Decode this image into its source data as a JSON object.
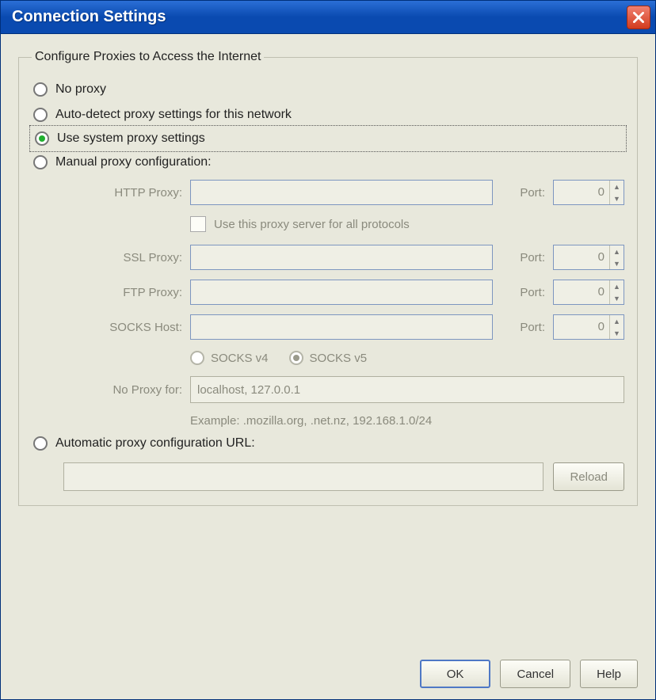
{
  "window": {
    "title": "Connection Settings"
  },
  "group": {
    "legend": "Configure Proxies to Access the Internet"
  },
  "radios": {
    "no_proxy": "No proxy",
    "auto_detect": "Auto-detect proxy settings for this network",
    "use_system": "Use system proxy settings",
    "manual": "Manual proxy configuration:",
    "auto_url": "Automatic proxy configuration URL:"
  },
  "manual": {
    "http_label": "HTTP Proxy:",
    "http_value": "",
    "port_label": "Port:",
    "http_port": "0",
    "use_all_label": "Use this proxy server for all protocols",
    "ssl_label": "SSL Proxy:",
    "ssl_value": "",
    "ssl_port": "0",
    "ftp_label": "FTP Proxy:",
    "ftp_value": "",
    "ftp_port": "0",
    "socks_label": "SOCKS Host:",
    "socks_value": "",
    "socks_port": "0",
    "socks_v4": "SOCKS v4",
    "socks_v5": "SOCKS v5",
    "noproxy_label": "No Proxy for:",
    "noproxy_value": "localhost, 127.0.0.1",
    "example": "Example: .mozilla.org, .net.nz, 192.168.1.0/24"
  },
  "pac": {
    "url": "",
    "reload_label": "Reload"
  },
  "buttons": {
    "ok": "OK",
    "cancel": "Cancel",
    "help": "Help"
  }
}
